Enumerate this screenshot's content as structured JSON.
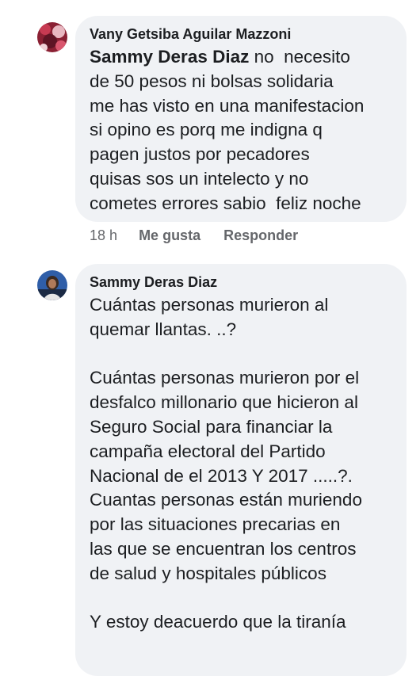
{
  "comments": [
    {
      "author": "Vany Getsiba Aguilar Mazzoni",
      "mention": "Sammy Deras Diaz",
      "text": " no  necesito\nde 50 pesos ni bolsas solidaria\nme has visto en una manifestacion\nsi opino es porq me indigna q\npagen justos por pecadores\nquisas sos un intelecto y no\ncometes errores sabio  feliz noche",
      "time": "18 h",
      "like_label": "Me gusta",
      "reply_label": "Responder"
    },
    {
      "author": "Sammy Deras Diaz",
      "text": "Cuántas personas murieron al\nquemar llantas. ..?\n\nCuántas personas murieron por el\ndesfalco millonario que hicieron al\nSeguro Social para financiar la\ncampaña electoral del Partido\nNacional de el 2013 Y 2017 .....?.\nCuantas personas están muriendo\npor las situaciones precarias en\nlas que se encuentran los centros\nde salud y hospitales públicos\n\nY estoy deacuerdo que la tiranía"
    }
  ],
  "colors": {
    "bubble_background": "#f0f2f5",
    "text": "#1c1e21",
    "meta_text": "#65676b"
  }
}
